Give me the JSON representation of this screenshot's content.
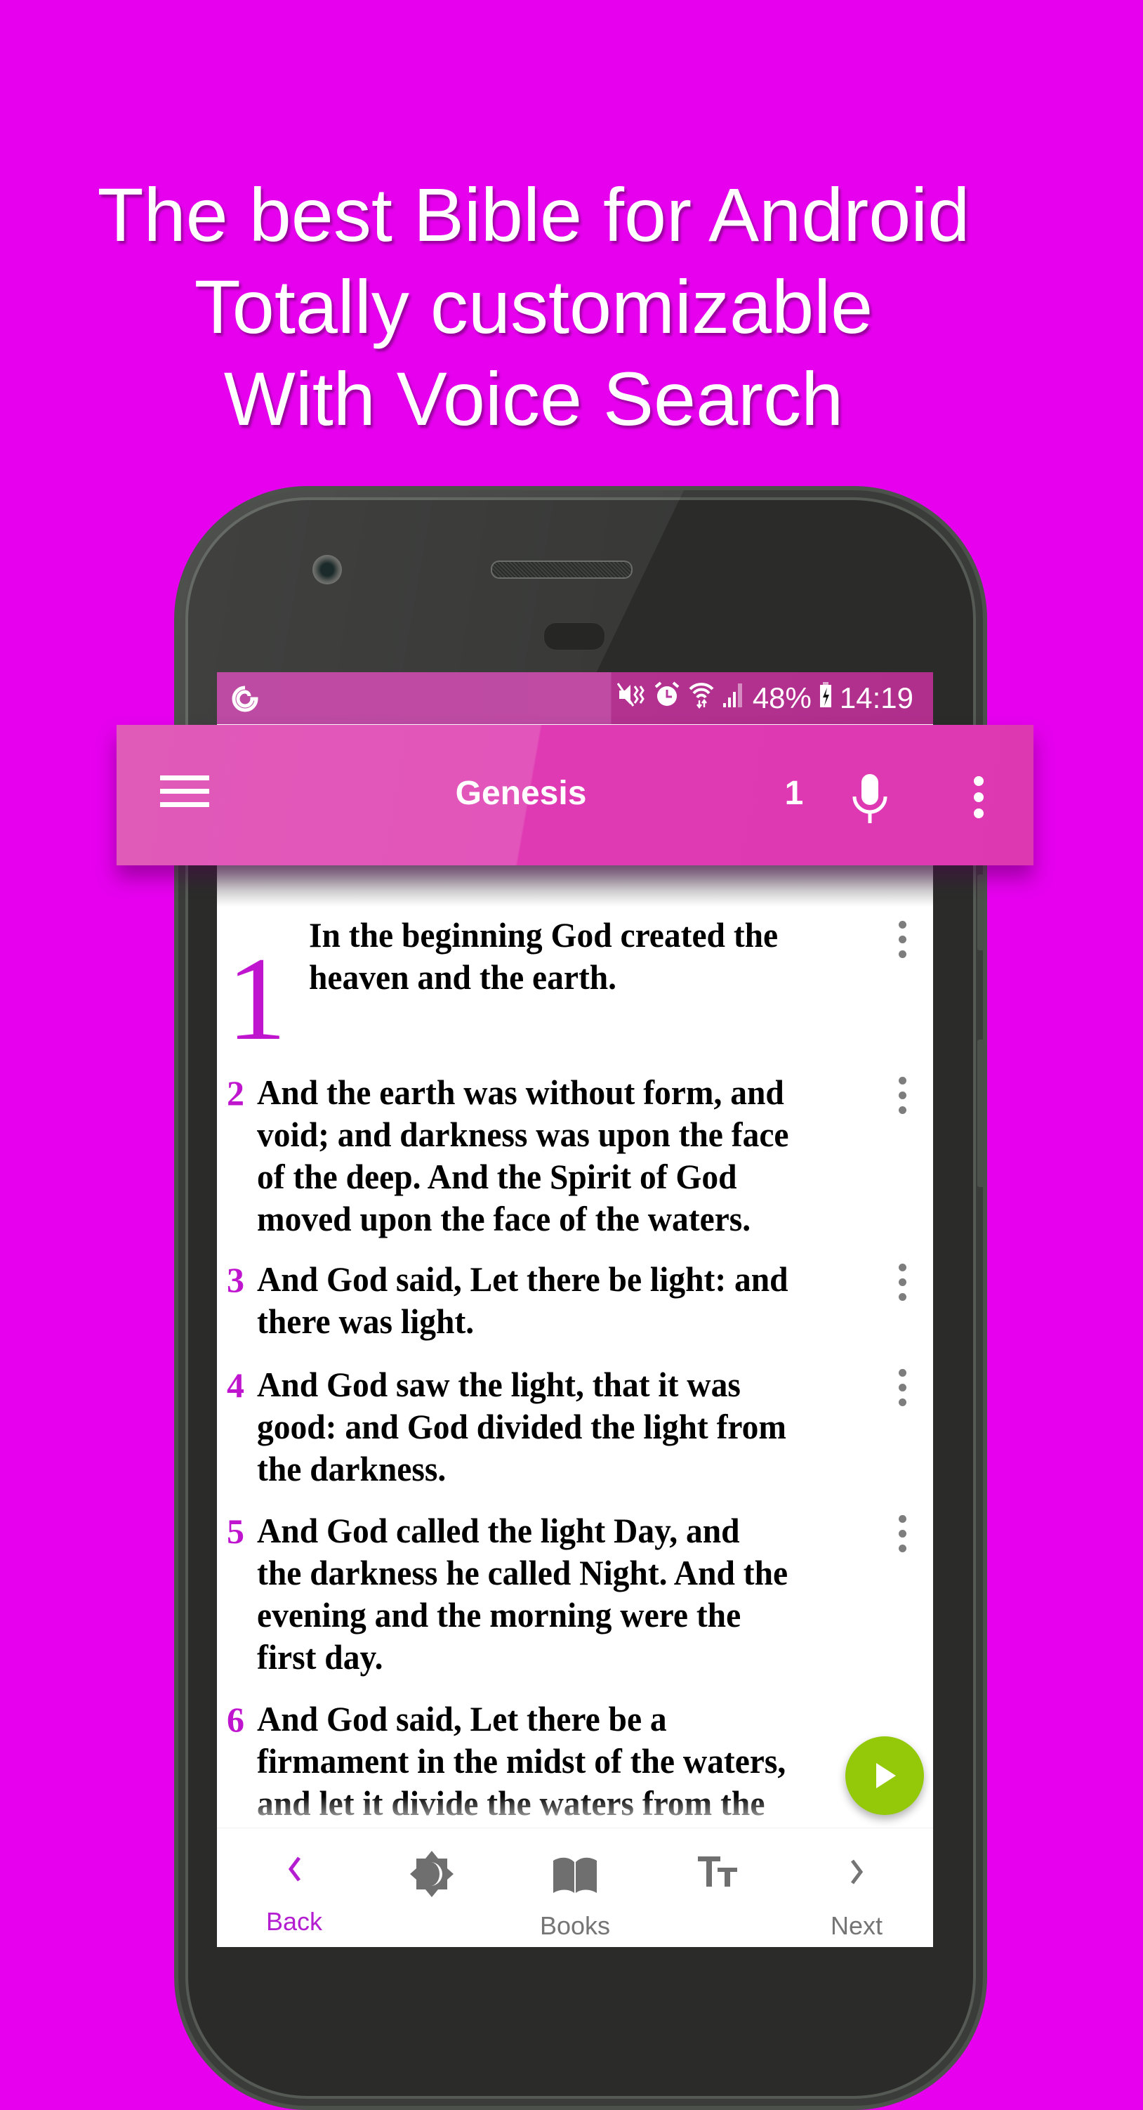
{
  "headline": {
    "lines": [
      "The best Bible for Android",
      "Totally customizable",
      "With Voice Search"
    ]
  },
  "colors": {
    "background": "#e600ee",
    "toolbar": "#e055b8",
    "status_bar": "#b8379a",
    "verse_number": "#c015cf",
    "nav_active": "#b41ed1",
    "nav_inactive": "#757575",
    "fab": "#94c90a"
  },
  "status_bar": {
    "left_icon": "notification-app-icon",
    "icons": [
      "mute-vibrate-icon",
      "alarm-icon",
      "wifi-icon",
      "signal-icon"
    ],
    "battery": "48%",
    "battery_icon": "battery-charging-icon",
    "time": "14:19"
  },
  "toolbar": {
    "menu_icon": "hamburger-menu-icon",
    "book": "Genesis",
    "chapter": "1",
    "mic_icon": "microphone-icon",
    "more_icon": "more-vert-icon"
  },
  "verses": [
    {
      "number": "1",
      "text": "In the beginning God created the\nheaven and the earth."
    },
    {
      "number": "2",
      "text": "And the earth was without form, and\nvoid; and darkness was upon the face\nof the deep. And the Spirit of God\nmoved upon the face of the waters."
    },
    {
      "number": "3",
      "text": "And God said, Let there be light: and\nthere was light."
    },
    {
      "number": "4",
      "text": "And God saw the light, that it was\ngood: and God divided the light from\nthe darkness."
    },
    {
      "number": "5",
      "text": "And God called the light Day, and\nthe darkness he called Night. And the\nevening and the morning were the\nfirst day."
    },
    {
      "number": "6",
      "text": "And God said, Let there be a\nfirmament in the midst of the waters,\nand let it divide the waters from the"
    }
  ],
  "fab": {
    "icon": "play-icon"
  },
  "bottom_nav": [
    {
      "label": "Back",
      "icon": "chevron-left-icon",
      "active": true
    },
    {
      "label": "",
      "icon": "night-mode-icon",
      "active": false
    },
    {
      "label": "Books",
      "icon": "book-open-icon",
      "active": false
    },
    {
      "label": "",
      "icon": "text-size-icon",
      "active": false
    },
    {
      "label": "Next",
      "icon": "chevron-right-icon",
      "active": false
    }
  ]
}
